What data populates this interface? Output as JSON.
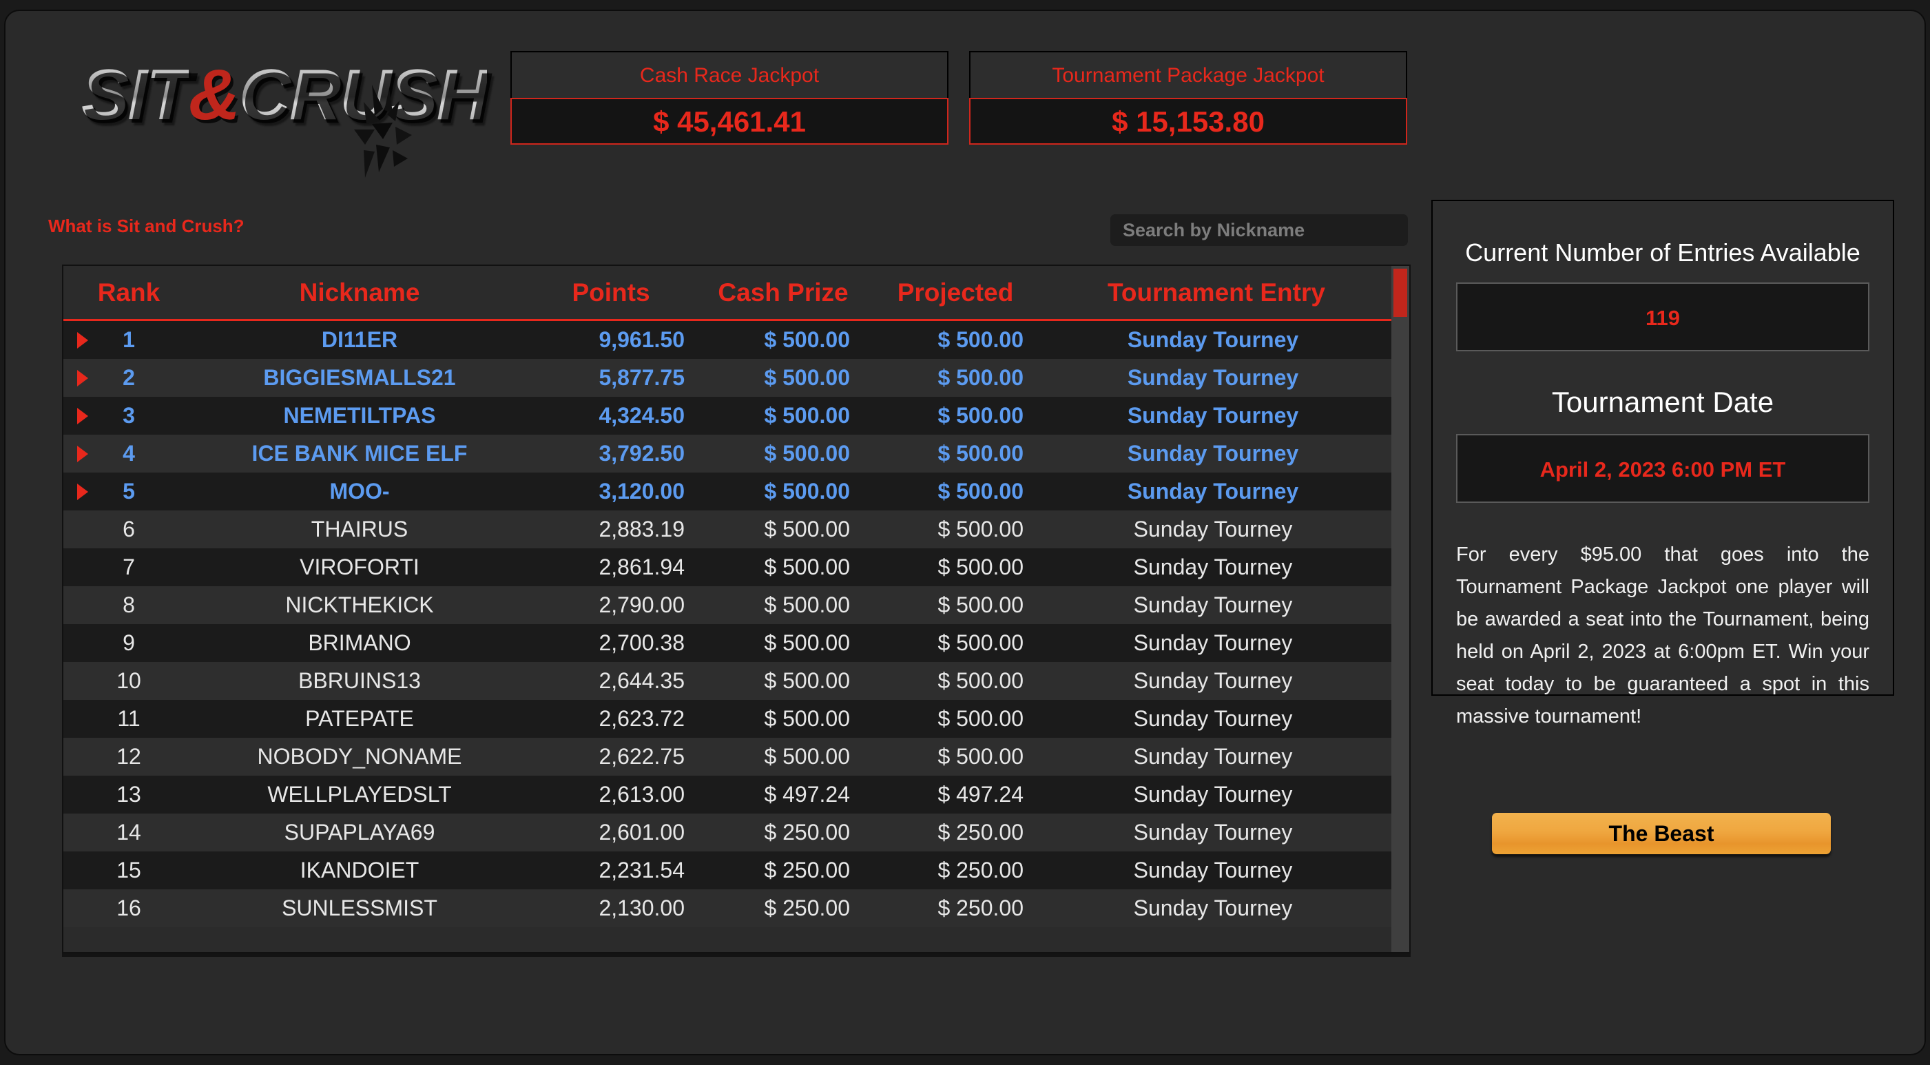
{
  "brand": {
    "logo_part1": "SIT",
    "logo_amp": "&",
    "logo_part2": "CRUSH"
  },
  "header": {
    "jackpots": [
      {
        "label": "Cash Race Jackpot",
        "value": "$ 45,461.41"
      },
      {
        "label": "Tournament Package Jackpot",
        "value": "$ 15,153.80"
      }
    ]
  },
  "toolbar": {
    "what_is_link": "What is Sit and Crush?",
    "search_placeholder": "Search by Nickname",
    "search_value": ""
  },
  "leaderboard": {
    "columns": [
      "Rank",
      "Nickname",
      "Points",
      "Cash Prize",
      "Projected",
      "Tournament Entry"
    ],
    "rows": [
      {
        "rank": "1",
        "nickname": "DI11ER",
        "points": "9,961.50",
        "cash": "$ 500.00",
        "projected": "$ 500.00",
        "entry": "Sunday Tourney"
      },
      {
        "rank": "2",
        "nickname": "BIGGIESMALLS21",
        "points": "5,877.75",
        "cash": "$ 500.00",
        "projected": "$ 500.00",
        "entry": "Sunday Tourney"
      },
      {
        "rank": "3",
        "nickname": "NEMETILTPAS",
        "points": "4,324.50",
        "cash": "$ 500.00",
        "projected": "$ 500.00",
        "entry": "Sunday Tourney"
      },
      {
        "rank": "4",
        "nickname": "ICE BANK MICE ELF",
        "points": "3,792.50",
        "cash": "$ 500.00",
        "projected": "$ 500.00",
        "entry": "Sunday Tourney"
      },
      {
        "rank": "5",
        "nickname": "MOO-",
        "points": "3,120.00",
        "cash": "$ 500.00",
        "projected": "$ 500.00",
        "entry": "Sunday Tourney"
      },
      {
        "rank": "6",
        "nickname": "THAIRUS",
        "points": "2,883.19",
        "cash": "$ 500.00",
        "projected": "$ 500.00",
        "entry": "Sunday Tourney"
      },
      {
        "rank": "7",
        "nickname": "VIROFORTI",
        "points": "2,861.94",
        "cash": "$ 500.00",
        "projected": "$ 500.00",
        "entry": "Sunday Tourney"
      },
      {
        "rank": "8",
        "nickname": "NICKTHEKICK",
        "points": "2,790.00",
        "cash": "$ 500.00",
        "projected": "$ 500.00",
        "entry": "Sunday Tourney"
      },
      {
        "rank": "9",
        "nickname": "BRIMANO",
        "points": "2,700.38",
        "cash": "$ 500.00",
        "projected": "$ 500.00",
        "entry": "Sunday Tourney"
      },
      {
        "rank": "10",
        "nickname": "BBRUINS13",
        "points": "2,644.35",
        "cash": "$ 500.00",
        "projected": "$ 500.00",
        "entry": "Sunday Tourney"
      },
      {
        "rank": "11",
        "nickname": "PATEPATE",
        "points": "2,623.72",
        "cash": "$ 500.00",
        "projected": "$ 500.00",
        "entry": "Sunday Tourney"
      },
      {
        "rank": "12",
        "nickname": "NOBODY_NONAME",
        "points": "2,622.75",
        "cash": "$ 500.00",
        "projected": "$ 500.00",
        "entry": "Sunday Tourney"
      },
      {
        "rank": "13",
        "nickname": "WELLPLAYEDSLT",
        "points": "2,613.00",
        "cash": "$ 497.24",
        "projected": "$ 497.24",
        "entry": "Sunday Tourney"
      },
      {
        "rank": "14",
        "nickname": "SUPAPLAYA69",
        "points": "2,601.00",
        "cash": "$ 250.00",
        "projected": "$ 250.00",
        "entry": "Sunday Tourney"
      },
      {
        "rank": "15",
        "nickname": "IKANDOIET",
        "points": "2,231.54",
        "cash": "$ 250.00",
        "projected": "$ 250.00",
        "entry": "Sunday Tourney"
      },
      {
        "rank": "16",
        "nickname": "SUNLESSMIST",
        "points": "2,130.00",
        "cash": "$ 250.00",
        "projected": "$ 250.00",
        "entry": "Sunday Tourney"
      }
    ],
    "highlighted_rank_count": 5
  },
  "side_panel": {
    "entries_title": "Current Number of Entries Available",
    "entries_value": "119",
    "date_title": "Tournament Date",
    "date_value": "April 2, 2023 6:00 PM ET",
    "description": "For every $95.00 that goes into the Tournament Package Jackpot one player will be awarded a seat into the Tournament, being held on April 2, 2023 at 6:00pm ET. Win your seat today to be guaranteed a spot in this massive tournament!"
  },
  "beast_button": {
    "label": "The Beast"
  },
  "colors": {
    "accent_red": "#e8281c",
    "highlight_blue": "#5c9bf0",
    "button_orange": "#efa740",
    "page_bg": "#2a2a2a"
  }
}
